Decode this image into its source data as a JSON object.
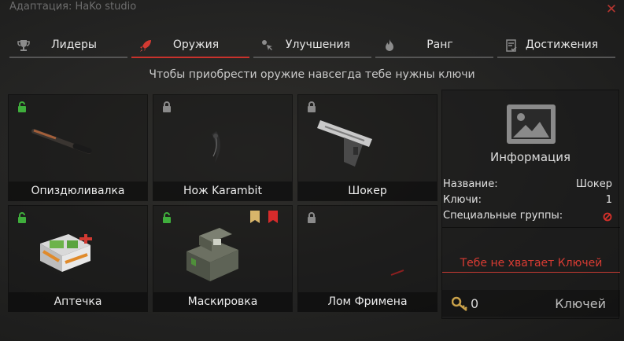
{
  "window": {
    "title": "Адаптация: HaKo studio"
  },
  "tabs": [
    {
      "label": "Лидеры",
      "icon": "trophy-icon"
    },
    {
      "label": "Оружия",
      "icon": "rocket-icon",
      "active": true
    },
    {
      "label": "Улучшения",
      "icon": "upgrade-cursor-icon"
    },
    {
      "label": "Ранг",
      "icon": "flame-icon"
    },
    {
      "label": "Достижения",
      "icon": "checklist-icon"
    }
  ],
  "notice": "Чтобы приобрести оружие навсегда тебе нужны ключи",
  "items": [
    {
      "label": "Опиздюливалка",
      "locked": false,
      "art": "baton"
    },
    {
      "label": "Нож Karambit",
      "locked": true,
      "art": "karambit"
    },
    {
      "label": "Шокер",
      "locked": true,
      "art": "pistol"
    },
    {
      "label": "Аптечка",
      "locked": false,
      "art": "medkit"
    },
    {
      "label": "Маскировка",
      "locked": false,
      "art": "disguise-box",
      "flags": [
        "#d8b56a",
        "#d62b2b"
      ]
    },
    {
      "label": "Лом Фримена",
      "locked": true,
      "art": "crowbar"
    }
  ],
  "info": {
    "title": "Информация",
    "name_label": "Название:",
    "name_value": "Шокер",
    "keys_label": "Ключи:",
    "keys_value": "1",
    "groups_label": "Специальные группы:",
    "groups_icon": "prohibited-icon",
    "warning": "Тебе не хватает Ключей",
    "balance": "0",
    "balance_label": "Ключей"
  },
  "colors": {
    "accent": "#c8322c",
    "unlocked": "#3fae3c",
    "locked": "#8a8a8a",
    "key": "#c9a14a"
  }
}
